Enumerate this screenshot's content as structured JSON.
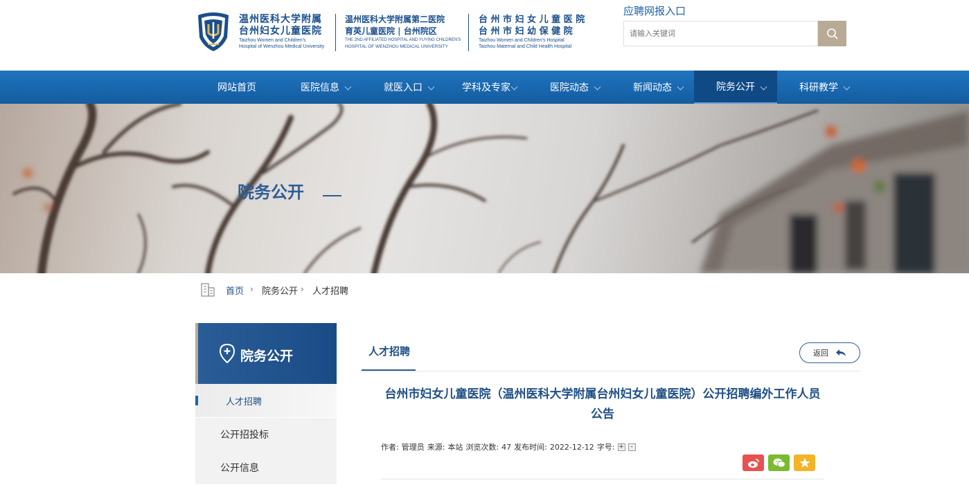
{
  "header": {
    "logos": [
      {
        "line1": "温州医科大学附属",
        "line2": "台州妇女儿童医院",
        "line3a": "Taizhou Women and Children's",
        "line3b": "Hospital of Wenzhou Medical University"
      },
      {
        "line1": "温州医科大学附属第二医院",
        "line2": "育英儿童医院 | 台州院区",
        "line3a": "THE 2ND AFFILIATED HOSPITAL AND YUYING CHILDREN'S",
        "line3b": "HOSPITAL OF WENZHOU MEDICAL UNIVERSITY"
      },
      {
        "line1": "台 州 市 妇 女 儿 童 医 院",
        "line2": "台 州 市 妇 幼 保 健 院",
        "line3a": "Taizhou Women and Children's Hospital",
        "line3b": "Taizhou Maternal and Child Health Hospital"
      }
    ],
    "recruit_link": "应聘网报入口",
    "search_placeholder": "请输入关键词",
    "brand_color": "#1b4f8c"
  },
  "nav": {
    "items": [
      {
        "label": "网站首页"
      },
      {
        "label": "医院信息"
      },
      {
        "label": "就医入口"
      },
      {
        "label": "学科及专家"
      },
      {
        "label": "医院动态"
      },
      {
        "label": "新闻动态"
      },
      {
        "label": "院务公开"
      },
      {
        "label": "科研教学"
      }
    ],
    "active_index": 6
  },
  "banner": {
    "title": "院务公开"
  },
  "breadcrumb": {
    "home": "首页",
    "section": "院务公开",
    "current": "人才招聘",
    "sep": "›"
  },
  "sidebar": {
    "title": "院务公开",
    "items": [
      {
        "label": "人才招聘"
      },
      {
        "label": "公开招投标"
      },
      {
        "label": "公开信息"
      }
    ]
  },
  "content": {
    "tab_title": "人才招聘",
    "back_label": "返回",
    "article_title": "台州市妇女儿童医院（温州医科大学附属台州妇女儿童医院）公开招聘编外工作人员公告",
    "meta": {
      "author_label": "作者:",
      "author": "管理员",
      "source_label": "来源:",
      "source": "本站",
      "views_label": "浏览次数:",
      "views": "47",
      "date_label": "发布时间:",
      "date": "2022-12-12",
      "font_label": "字号:",
      "font_plus": "+",
      "font_minus": "-"
    },
    "share": [
      {
        "icon": "weibo-icon",
        "color": "#e8514f"
      },
      {
        "icon": "wechat-icon",
        "color": "#7bbb2f"
      },
      {
        "icon": "star-icon",
        "color": "#f3b427"
      }
    ]
  }
}
